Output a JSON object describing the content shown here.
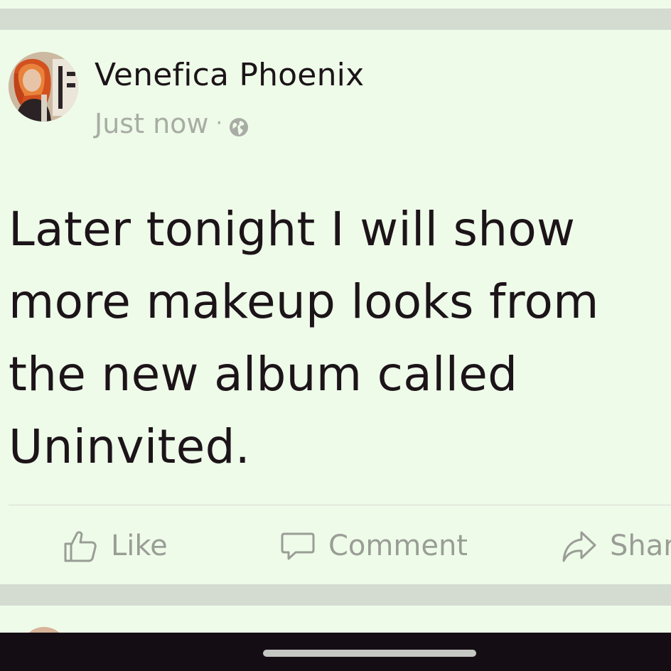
{
  "post": {
    "author": "Venefica Phoenix",
    "timestamp": "Just now",
    "separator": "·",
    "audience_icon": "globe-icon",
    "text": "Later tonight I will show more makeup looks from the new album called Uninvited."
  },
  "actions": {
    "like_label": "Like",
    "like_icon": "thumbs-up-icon",
    "comment_label": "Comment",
    "comment_icon": "speech-bubble-icon",
    "share_label": "Shar",
    "share_icon": "share-arrow-icon"
  },
  "colors": {
    "background": "#eefbe9",
    "divider": "#d4dbd1",
    "text": "#1c1419",
    "muted": "#a9aca5",
    "nav_bar": "#150d14"
  }
}
